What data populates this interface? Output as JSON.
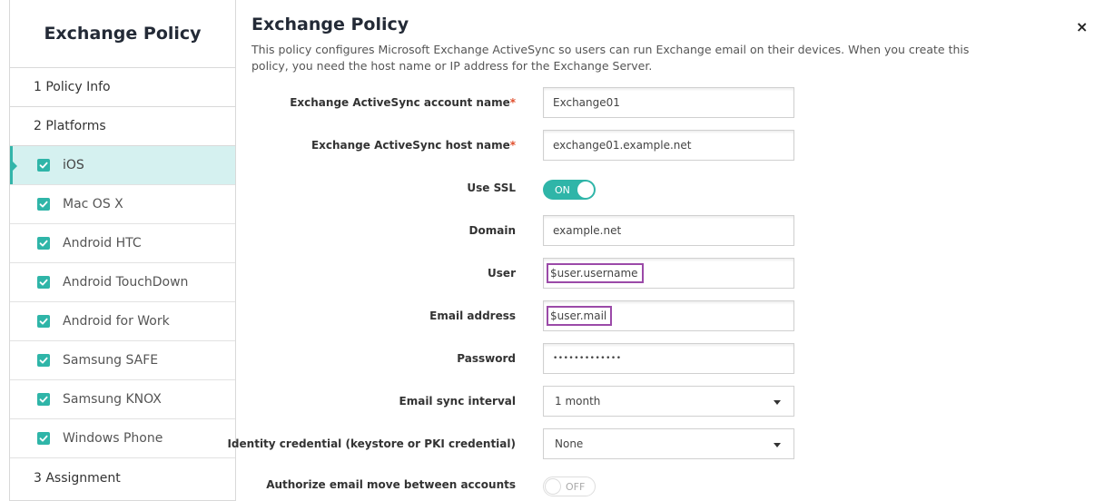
{
  "sidebar": {
    "title": "Exchange Policy",
    "step1": "1  Policy Info",
    "step2": "2  Platforms",
    "step3": "3  Assignment",
    "platforms": [
      "iOS",
      "Mac OS X",
      "Android HTC",
      "Android TouchDown",
      "Android for Work",
      "Samsung SAFE",
      "Samsung KNOX",
      "Windows Phone"
    ],
    "active_platform": "iOS"
  },
  "main": {
    "title": "Exchange Policy",
    "description": "This policy configures Microsoft Exchange ActiveSync so users can run Exchange email on their devices. When you create this policy, you need the host name or IP address for the Exchange Server.",
    "close_glyph": "×"
  },
  "form": {
    "account_name": {
      "label": "Exchange ActiveSync account name",
      "required": "*",
      "value": "Exchange01"
    },
    "host_name": {
      "label": "Exchange ActiveSync host name",
      "required": "*",
      "value": "exchange01.example.net"
    },
    "use_ssl": {
      "label": "Use SSL",
      "state": "ON"
    },
    "domain": {
      "label": "Domain",
      "value": "example.net"
    },
    "user": {
      "label": "User",
      "value": "$user.username"
    },
    "email": {
      "label": "Email address",
      "value": "$user.mail"
    },
    "password": {
      "label": "Password",
      "value": "•••••••••••••"
    },
    "sync_interval": {
      "label": "Email sync interval",
      "value": "1 month"
    },
    "identity_credential": {
      "label": "Identity credential (keystore or PKI credential)",
      "value": "None"
    },
    "authorize_move": {
      "label": "Authorize email move between accounts",
      "state": "OFF"
    }
  },
  "colors": {
    "accent": "#2fb5a8",
    "active_row": "#d5f1f0",
    "highlight": "#9b4aa8",
    "required": "#e0502f"
  }
}
